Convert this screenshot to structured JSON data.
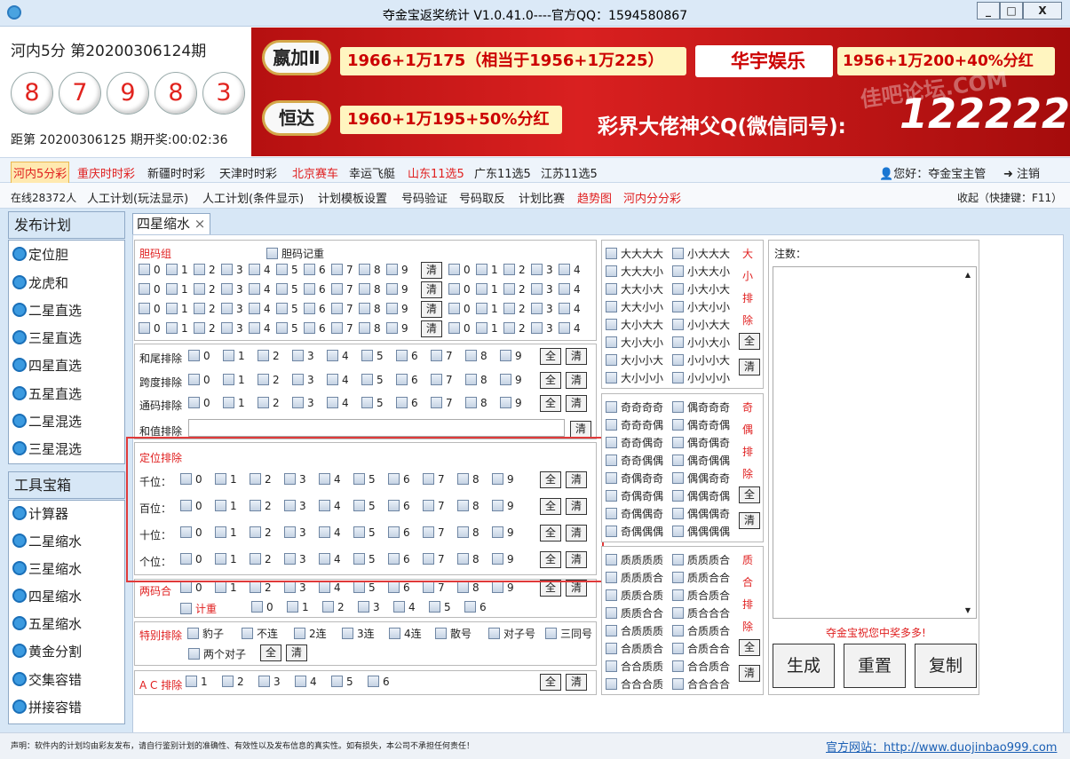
{
  "window": {
    "title": "夺金宝返奖统计  V1.0.41.0----官方QQ：1594580867",
    "min": "_",
    "max": "□",
    "close": "X"
  },
  "info": {
    "issue": "河内5分  第20200306124期",
    "balls": [
      "8",
      "7",
      "9",
      "8",
      "3"
    ],
    "countdown": "距第 20200306125 期开奖:00:02:36"
  },
  "banner": {
    "logo1": "嬴加Ⅱ",
    "text1": "1966+1万175（相当于1956+1万225）",
    "logo2": "华宇娱乐",
    "text2": "1956+1万200+40%分红",
    "logo3": "恒达",
    "text3": "1960+1万195+50%分红",
    "text4": "彩界大佬神父Q(微信同号):",
    "num4": "122222",
    "watermark": "佳吧论坛.COM"
  },
  "lotteryNav": {
    "items": [
      "河内5分彩",
      "重庆时时彩",
      "新疆时时彩",
      "天津时时彩",
      "北京赛车",
      "幸运飞艇",
      "山东11选5",
      "广东11选5",
      "江苏11选5"
    ],
    "user": "您好：夺金宝主管",
    "logout": "注销"
  },
  "menu": {
    "online": "在线28372人",
    "items": [
      "人工计划(玩法显示)",
      "人工计划(条件显示)",
      "计划模板设置",
      "号码验证",
      "号码取反",
      "计划比赛",
      "趋势图",
      "河内分分彩"
    ],
    "collapse": "收起（快捷键：F11）"
  },
  "sidebar": {
    "plan_title": "发布计划",
    "plan_items": [
      "定位胆",
      "龙虎和",
      "二星直选",
      "三星直选",
      "四星直选",
      "五星直选",
      "二星混选",
      "三星混选"
    ],
    "tools_title": "工具宝箱",
    "tool_items": [
      "计算器",
      "二星缩水",
      "三星缩水",
      "四星缩水",
      "五星缩水",
      "黄金分割",
      "交集容错",
      "拼接容错"
    ]
  },
  "tab": {
    "label": "四星缩水",
    "close": "×"
  },
  "dan": {
    "title": "胆码组",
    "record": "胆码记重",
    "digits": [
      "0",
      "1",
      "2",
      "3",
      "4",
      "5",
      "6",
      "7",
      "8",
      "9"
    ],
    "digits5": [
      "0",
      "1",
      "2",
      "3",
      "4"
    ],
    "clear": "清"
  },
  "excl": {
    "hewei": "和尾排除",
    "kuadu": "跨度排除",
    "tongma": "通码排除",
    "hezhi": "和值排除",
    "all": "全",
    "clear": "清"
  },
  "dingwei": {
    "title": "定位排除",
    "rows": [
      "千位：",
      "百位：",
      "十位：",
      "个位："
    ]
  },
  "liangma": {
    "title": "两码合",
    "jizhong": "计重",
    "nums": [
      "0",
      "1",
      "2",
      "3",
      "4",
      "5",
      "6"
    ]
  },
  "special": {
    "title": "特别排除",
    "items": [
      "豹子",
      "不连",
      "2连",
      "3连",
      "4连",
      "散号",
      "对子号",
      "三同号"
    ],
    "pairs": "两个对子"
  },
  "ac": {
    "title": "A C 排除",
    "nums": [
      "1",
      "2",
      "3",
      "4",
      "5",
      "6"
    ]
  },
  "bigsmall": {
    "col1": [
      "大大大大",
      "大大大小",
      "大大小大",
      "大大小小",
      "大小大大",
      "大小大小",
      "大小小大",
      "大小小小"
    ],
    "col2": [
      "小大大大",
      "小大大小",
      "小大小大",
      "小大小小",
      "小小大大",
      "小小大小",
      "小小小大",
      "小小小小"
    ],
    "label": [
      "大",
      "小",
      "排",
      "除"
    ]
  },
  "oddeven": {
    "col1": [
      "奇奇奇奇",
      "奇奇奇偶",
      "奇奇偶奇",
      "奇奇偶偶",
      "奇偶奇奇",
      "奇偶奇偶",
      "奇偶偶奇",
      "奇偶偶偶"
    ],
    "col2": [
      "偶奇奇奇",
      "偶奇奇偶",
      "偶奇偶奇",
      "偶奇偶偶",
      "偶偶奇奇",
      "偶偶奇偶",
      "偶偶偶奇",
      "偶偶偶偶"
    ],
    "label": [
      "奇",
      "偶",
      "排",
      "除"
    ]
  },
  "primecomp": {
    "col1": [
      "质质质质",
      "质质质合",
      "质质合质",
      "质质合合",
      "合质质质",
      "合质质合",
      "合合质质",
      "合合合质"
    ],
    "col2": [
      "质质质合",
      "质质合合",
      "质合质合",
      "质合合合",
      "合质质合",
      "合质合合",
      "合合质合",
      "合合合合"
    ],
    "label": [
      "质",
      "合",
      "排",
      "除"
    ]
  },
  "notes": {
    "label": "注数：",
    "wish": "夺金宝祝您中奖多多!",
    "generate": "生成",
    "reset": "重置",
    "copy": "复制"
  },
  "status": {
    "disclaimer": "声明：软件内的计划均由彩友发布，请自行鉴别计划的准确性、有效性以及发布信息的真实性。如有损失，本公司不承担任何责任！",
    "site": "官方网站：http://www.duojinbao999.com"
  },
  "colors": {
    "red": "#e02020",
    "accent": "#1a6fb8",
    "banner": "#c41414"
  }
}
